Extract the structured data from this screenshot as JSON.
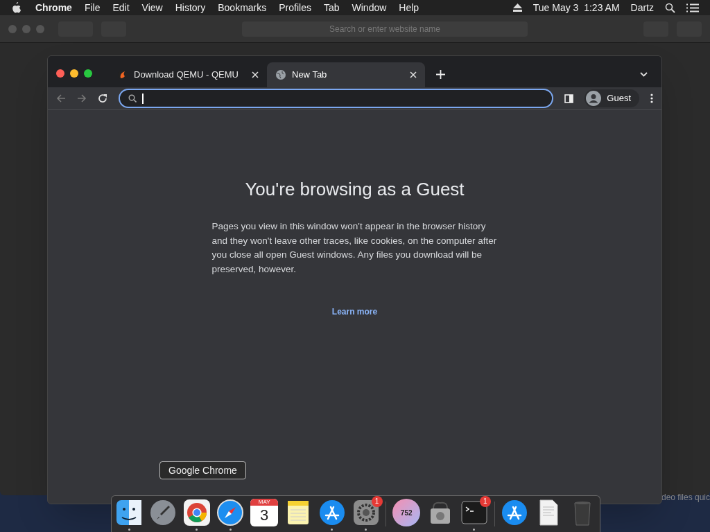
{
  "menu_bar": {
    "app": "Chrome",
    "items": [
      "File",
      "Edit",
      "View",
      "History",
      "Bookmarks",
      "Profiles",
      "Tab",
      "Window",
      "Help"
    ],
    "clock": "Tue May 3  1:23 AM",
    "user": "Dartz"
  },
  "background_window": {
    "address_placeholder": "Search or enter website name",
    "status_text": "deo files quic"
  },
  "browser": {
    "tabs": [
      {
        "title": "Download QEMU - QEMU",
        "kind": "site",
        "selected": false
      },
      {
        "title": "New Tab",
        "kind": "globe",
        "selected": true
      }
    ],
    "profile": "Guest",
    "page": {
      "heading": "You're browsing as a Guest",
      "body": "Pages you view in this window won't appear in the browser history and they won't leave other traces, like cookies, on the computer after you close all open Guest windows. Any files you download will be preserved, however.",
      "link": "Learn more"
    }
  },
  "dock": {
    "tooltip": "Google Chrome",
    "items": [
      {
        "kind": "finder",
        "running": true
      },
      {
        "kind": "launchpad",
        "running": false
      },
      {
        "kind": "chrome",
        "running": true
      },
      {
        "kind": "safari",
        "running": true
      },
      {
        "kind": "calendar",
        "running": false,
        "month": "MAY",
        "day": "3"
      },
      {
        "kind": "notes",
        "running": false
      },
      {
        "kind": "appstore",
        "running": true
      },
      {
        "kind": "settings",
        "running": true,
        "badge": "1"
      },
      {
        "kind": "divider"
      },
      {
        "kind": "counter",
        "running": false,
        "label": "752"
      },
      {
        "kind": "disk",
        "running": false
      },
      {
        "kind": "terminal",
        "running": true,
        "badge": "1"
      },
      {
        "kind": "divider"
      },
      {
        "kind": "appstore",
        "running": false
      },
      {
        "kind": "document",
        "running": false
      },
      {
        "kind": "trash",
        "running": false
      }
    ]
  }
}
